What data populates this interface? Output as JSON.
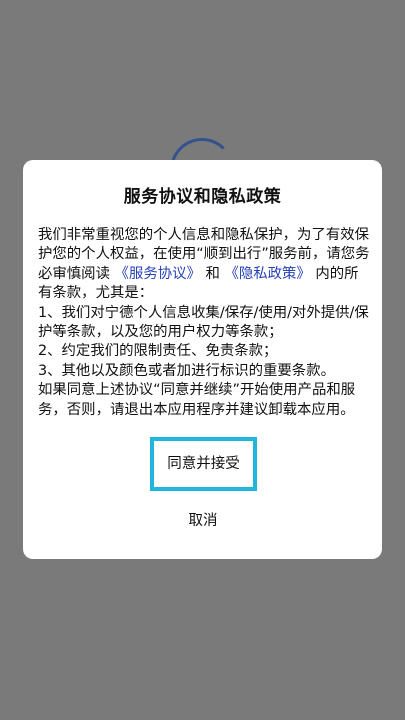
{
  "dialog": {
    "title": "服务协议和隐私政策",
    "intro_text": "我们非常重视您的个人信息和隐私保护，为了有效保护您的个人权益，在使用“顺到出行”服务前，请您务必审慎阅读",
    "link_service_agreement": "《服务协议》",
    "and_text": " 和 ",
    "link_privacy_policy": "《隐私政策》",
    "intro_tail": "内的所有条款，尤其是：",
    "item1": "1、我们对宁德个人信息收集/保存/使用/对外提供/保护等条款，以及您的用户权力等条款；",
    "item2": "2、约定我们的限制责任、免责条款；",
    "item3": "3、其他以及颜色或者加进行标识的重要条款。",
    "closing": "如果同意上述协议“同意并继续”开始使用产品和服务，否则，请退出本应用程序并建议卸载本应用。",
    "agree_label": "同意并接受",
    "cancel_label": "取消"
  },
  "colors": {
    "overlay": "#7a7a7a",
    "link": "#2742b8",
    "focus_highlight": "#21b6de"
  }
}
